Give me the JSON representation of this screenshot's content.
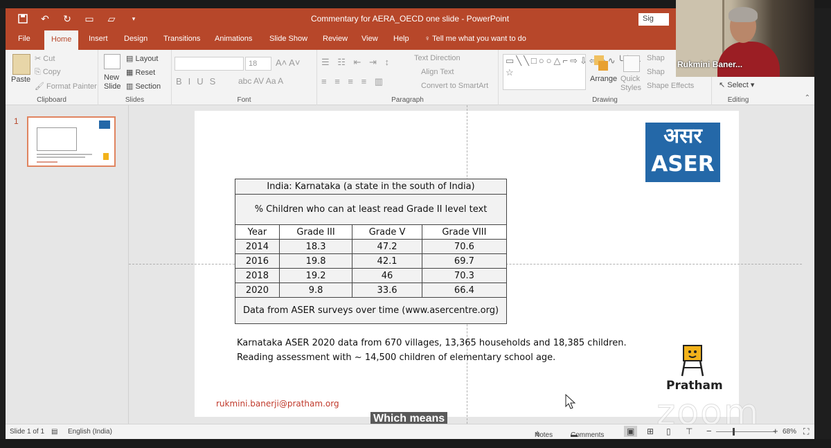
{
  "window": {
    "title": "Commentary for AERA_OECD one slide  -  PowerPoint",
    "signin": "Sig"
  },
  "tabs": [
    "File",
    "Home",
    "Insert",
    "Design",
    "Transitions",
    "Animations",
    "Slide Show",
    "Review",
    "View",
    "Help"
  ],
  "tell_me": "Tell me what you want to do",
  "ribbon": {
    "clipboard": {
      "label": "Clipboard",
      "paste": "Paste",
      "cut": "Cut",
      "copy": "Copy",
      "format_painter": "Format Painter"
    },
    "slides": {
      "label": "Slides",
      "new_slide": "New\nSlide",
      "layout": "Layout",
      "reset": "Reset",
      "section": "Section"
    },
    "font": {
      "label": "Font",
      "size": "18"
    },
    "paragraph": {
      "label": "Paragraph",
      "text_direction": "Text Direction",
      "align_text": "Align Text",
      "convert_smartart": "Convert to SmartArt"
    },
    "drawing": {
      "label": "Drawing",
      "arrange": "Arrange",
      "quick_styles": "Quick\nStyles",
      "shape_fill": "Shap",
      "shape_outline": "Shap",
      "shape_effects": "Shape Effects"
    },
    "editing": {
      "label": "Editing",
      "select": "Select"
    }
  },
  "thumbnail": {
    "number": "1"
  },
  "slide": {
    "table_title": "India: Karnataka (a state in the south of India)",
    "table_subtitle": "% Children who can at least read Grade II level text",
    "columns": [
      "Year",
      "Grade III",
      "Grade V",
      "Grade VIII"
    ],
    "rows": [
      [
        "2014",
        "18.3",
        "47.2",
        "70.6"
      ],
      [
        "2016",
        "19.8",
        "42.1",
        "69.7"
      ],
      [
        "2018",
        "19.2",
        "46",
        "70.3"
      ],
      [
        "2020",
        "9.8",
        "33.6",
        "66.4"
      ]
    ],
    "table_footer": "Data from ASER surveys over time (www.asercentre.org)",
    "note_line1": "Karnataka ASER 2020 data from 670 villages, 13,365 households and 18,385 children.",
    "note_line2": "Reading assessment with ~ 14,500 children of elementary school age.",
    "email": "rukmini.banerji@pratham.org",
    "logo_hindi": "असर",
    "logo_en": "ASER",
    "pratham": "Pratham"
  },
  "statusbar": {
    "slide_count": "Slide 1 of 1",
    "language": "English (India)",
    "notes": "Notes",
    "comments": "Comments",
    "zoom": "68%"
  },
  "zoom_overlay": {
    "watermark": "zoom",
    "caption": "Which means",
    "participant_name": "Rukmini Baner..."
  },
  "colors": {
    "accent": "#b7472a",
    "aser_blue": "#2468a8",
    "email": "#c0392b"
  }
}
